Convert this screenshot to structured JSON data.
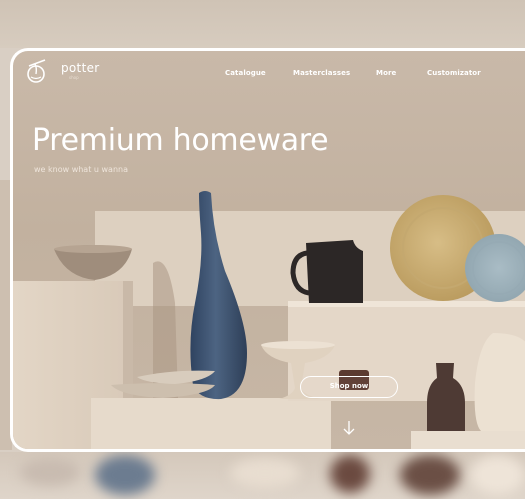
{
  "brand": {
    "name": "potter",
    "tagline": "shop"
  },
  "nav": {
    "items": [
      {
        "label": "Catalogue"
      },
      {
        "label": "Masterclasses"
      },
      {
        "label": "More"
      },
      {
        "label": "Customizator"
      }
    ]
  },
  "hero": {
    "title": "Premium homeware",
    "subtitle": "we know what u wanna",
    "cta_label": "Shop now"
  },
  "icons": {
    "logo": "pottery-vase-icon",
    "scroll": "arrow-down-icon"
  },
  "colors": {
    "frame_border": "#ffffff",
    "text": "#ffffff",
    "wall": "#c6b6a5",
    "vase_blue": "#3f5470",
    "plate_yellow": "#cfb277",
    "plate_blue": "#9fb3bd"
  }
}
